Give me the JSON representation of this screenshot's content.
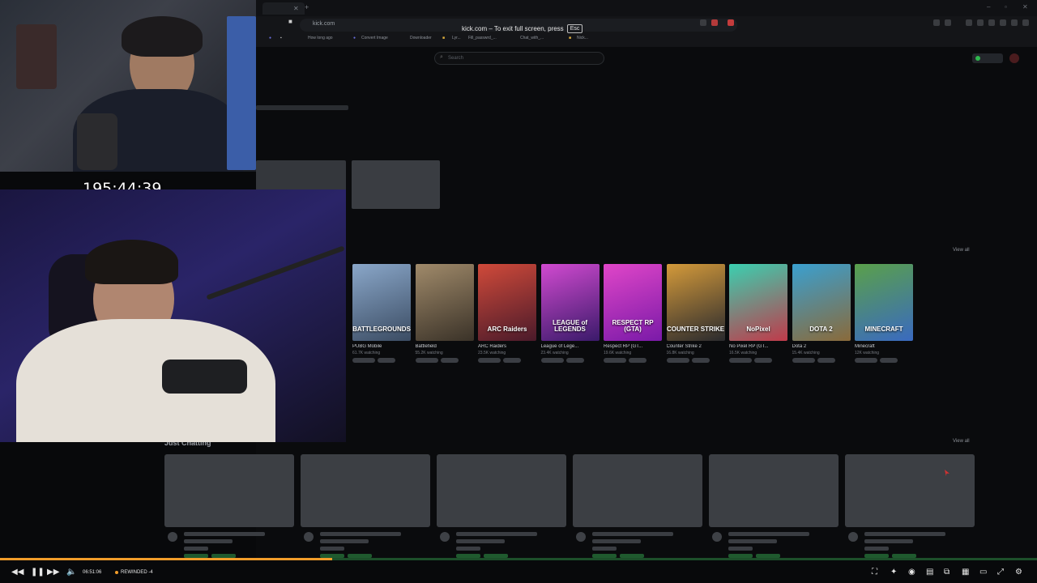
{
  "browser": {
    "address": "kick.com",
    "fullscreen_notice": "kick.com – To exit full screen, press",
    "esc_key": "Esc",
    "bookmarks": [
      "How long ago",
      "Convert Image",
      "Downloader",
      "Lyr...",
      "Fill_passwrd_...",
      "Chat_with_...",
      "Nick..."
    ]
  },
  "kick": {
    "search_placeholder": "Search",
    "view_all_1": "View all",
    "view_all_2": "View all",
    "section_title": "Just Chatting",
    "categories": [
      {
        "name": "PUBG Mobile",
        "viewers": "61.7K watching",
        "art": "BATTLEGROUNDS",
        "c1": "#8aa7c9",
        "c2": "#3b4c63"
      },
      {
        "name": "Battlefield",
        "viewers": "55.2K watching",
        "art": "",
        "c1": "#a08a6a",
        "c2": "#3a3228"
      },
      {
        "name": "ARC Raiders",
        "viewers": "23.5K watching",
        "art": "ARC Raiders",
        "c1": "#d04a3a",
        "c2": "#4a1a2a"
      },
      {
        "name": "League of Lege...",
        "viewers": "23.4K watching",
        "art": "LEAGUE of LEGENDS",
        "c1": "#d14ad0",
        "c2": "#3a1a6a"
      },
      {
        "name": "Respect RP (GT...",
        "viewers": "19.6K watching",
        "art": "RESPECT RP (GTA)",
        "c1": "#e046c8",
        "c2": "#7a1aa8"
      },
      {
        "name": "Counter Strike 2",
        "viewers": "16.8K watching",
        "art": "COUNTER STRIKE",
        "c1": "#d49a3a",
        "c2": "#2a2a2e"
      },
      {
        "name": "No Pixel RP (GT...",
        "viewers": "16.5K watching",
        "art": "NoPixel",
        "c1": "#3ad0b0",
        "c2": "#c03a4a"
      },
      {
        "name": "Dota 2",
        "viewers": "15.4K watching",
        "art": "DOTA 2",
        "c1": "#3aa0d0",
        "c2": "#8a6a3a"
      },
      {
        "name": "Minecraft",
        "viewers": "12K watching",
        "art": "MINECRAFT",
        "c1": "#5aa04a",
        "c2": "#3a6ac0"
      }
    ]
  },
  "overlay": {
    "timer": "195:44:39"
  },
  "player": {
    "time": "06:51:06",
    "status": "REWINDED -4",
    "progress_fraction": 0.32
  }
}
